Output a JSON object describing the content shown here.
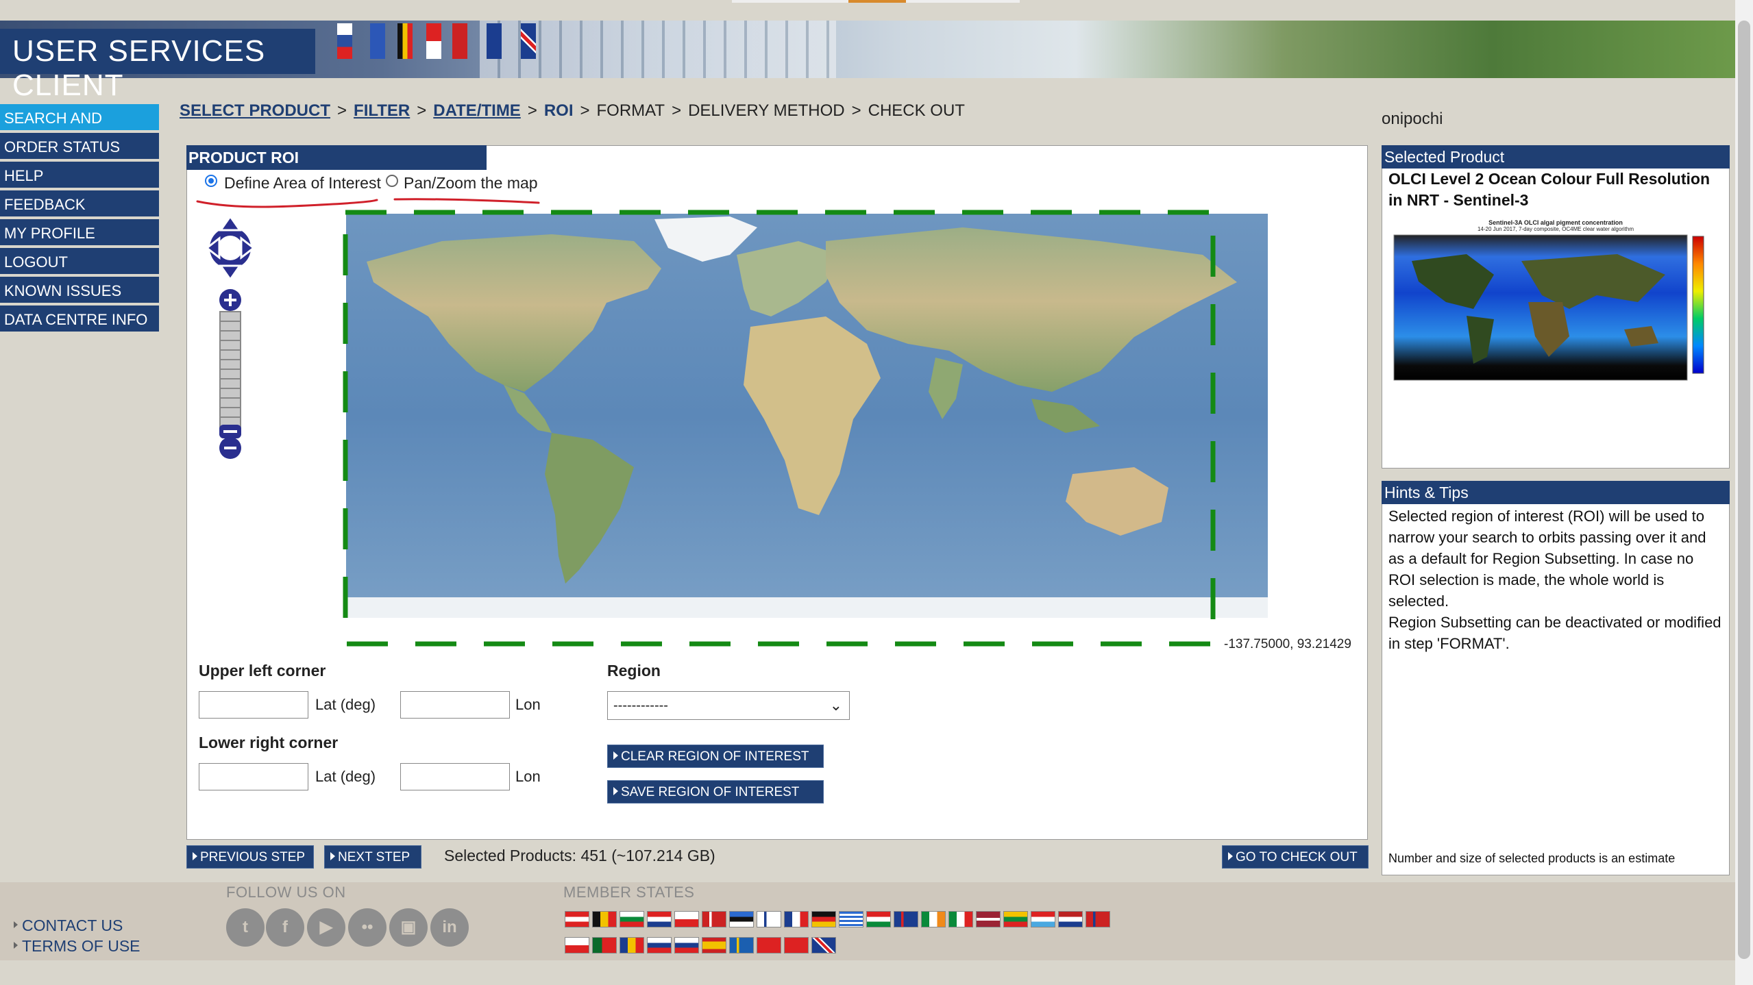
{
  "app": {
    "title": "USER SERVICES CLIENT",
    "username": "onipochi"
  },
  "nav": {
    "items": [
      {
        "label": "SEARCH AND ORDER",
        "active": true
      },
      {
        "label": "ORDER STATUS"
      },
      {
        "label": "HELP"
      },
      {
        "label": "FEEDBACK"
      },
      {
        "label": "MY PROFILE"
      },
      {
        "label": "LOGOUT"
      },
      {
        "label": "KNOWN ISSUES"
      },
      {
        "label": "DATA CENTRE INFO"
      }
    ]
  },
  "breadcrumb": {
    "select_product": "SELECT PRODUCT",
    "filter": "FILTER",
    "date_time": "DATE/TIME",
    "roi": "ROI",
    "format": "FORMAT",
    "delivery_method": "DELIVERY METHOD",
    "check_out": "CHECK OUT",
    "separator": ">"
  },
  "roi_panel": {
    "title": "PRODUCT ROI",
    "radio_define": "Define Area of Interest",
    "radio_pan": "Pan/Zoom the map",
    "selected_mode": "define",
    "map_coordinates": "-137.75000, 93.21429",
    "upper_left_label": "Upper left corner",
    "lower_right_label": "Lower right corner",
    "lat_unit": "Lat (deg)",
    "lon_unit": "Lon",
    "upper_left_lat": "",
    "upper_left_lon": "",
    "lower_right_lat": "",
    "lower_right_lon": "",
    "region_label": "Region",
    "region_selected": "------------",
    "clear_button": "CLEAR REGION OF INTEREST",
    "save_button": "SAVE REGION OF INTEREST"
  },
  "bottom_bar": {
    "previous_step": "PREVIOUS STEP",
    "next_step": "NEXT STEP",
    "selected_products": "Selected Products: 451 (~107.214 GB)",
    "go_to_checkout": "GO TO CHECK OUT"
  },
  "selected_product": {
    "title": "Selected Product",
    "name": "OLCI Level 2 Ocean Colour Full Resolution in NRT - Sentinel-3",
    "thumb_title": "Sentinel-3A OLCI algal pigment concentration",
    "thumb_subtitle": "14-20 Jun 2017, 7-day composite, OC4ME clear water algorithm"
  },
  "hints": {
    "title": "Hints & Tips",
    "text_1": "Selected region of interest (ROI) will be used to narrow your search to orbits passing over it and as a default for Region Subsetting. In case no ROI selection is made, the whole world is selected.",
    "text_2": "Region Subsetting can be deactivated or modified in step 'FORMAT'.",
    "note": "Number and size of selected products is an estimate"
  },
  "footer": {
    "contact_us": "CONTACT US",
    "terms_of_use": "TERMS OF USE",
    "follow_us": "FOLLOW US ON",
    "member_states": "MEMBER STATES",
    "social_icons": [
      "twitter-icon",
      "facebook-icon",
      "youtube-icon",
      "flickr-icon",
      "instagram-icon",
      "linkedin-icon"
    ]
  },
  "colors": {
    "brand_navy": "#1f3f73",
    "nav_active": "#1ba0dd",
    "roi_dash": "#148a14",
    "annotation_red": "#d0202a"
  }
}
